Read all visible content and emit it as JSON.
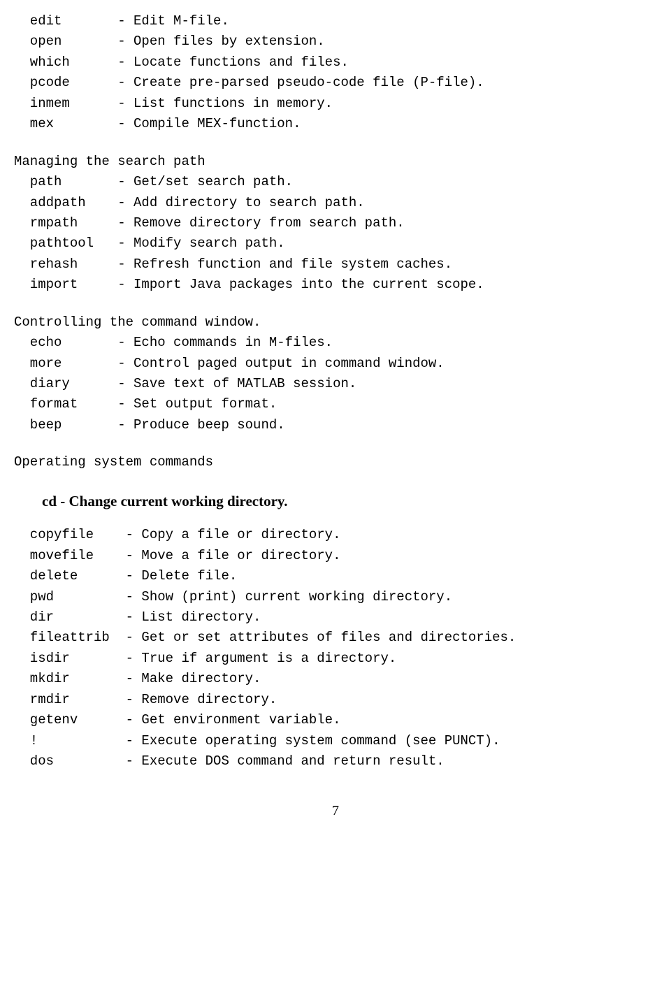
{
  "section0": [
    {
      "cmd": "  edit",
      "desc": "- Edit M-file."
    },
    {
      "cmd": "  open",
      "desc": "- Open files by extension."
    },
    {
      "cmd": "  which",
      "desc": "- Locate functions and files."
    },
    {
      "cmd": "  pcode",
      "desc": "- Create pre-parsed pseudo-code file (P-file)."
    },
    {
      "cmd": "  inmem",
      "desc": "- List functions in memory."
    },
    {
      "cmd": "  mex",
      "desc": "- Compile MEX-function."
    }
  ],
  "section1_title": "Managing the search path",
  "section1": [
    {
      "cmd": "  path",
      "desc": "- Get/set search path."
    },
    {
      "cmd": "  addpath",
      "desc": "- Add directory to search path."
    },
    {
      "cmd": "  rmpath",
      "desc": "- Remove directory from search path."
    },
    {
      "cmd": "  pathtool",
      "desc": "- Modify search path."
    },
    {
      "cmd": "  rehash",
      "desc": "- Refresh function and file system caches."
    },
    {
      "cmd": "  import",
      "desc": "- Import Java packages into the current scope."
    }
  ],
  "section2_title": "Controlling the command window.",
  "section2": [
    {
      "cmd": "  echo",
      "desc": "- Echo commands in M-files."
    },
    {
      "cmd": "  more",
      "desc": "- Control paged output in command window."
    },
    {
      "cmd": "  diary",
      "desc": "- Save text of MATLAB session."
    },
    {
      "cmd": "  format",
      "desc": "- Set output format."
    },
    {
      "cmd": "  beep",
      "desc": "- Produce beep sound."
    }
  ],
  "section3_title": "Operating system commands",
  "subheading_bold": "cd - Change current working directory.",
  "section4": [
    {
      "cmd": "  copyfile",
      "desc": "- Copy a file or directory."
    },
    {
      "cmd": "  movefile",
      "desc": "- Move a file or directory."
    },
    {
      "cmd": "  delete",
      "desc": "- Delete file."
    },
    {
      "cmd": "  pwd",
      "desc": "- Show (print) current working directory."
    },
    {
      "cmd": "  dir",
      "desc": "- List directory."
    },
    {
      "cmd": "  fileattrib",
      "desc": "- Get or set attributes of files and directories."
    },
    {
      "cmd": "  isdir",
      "desc": "- True if argument is a directory."
    },
    {
      "cmd": "  mkdir",
      "desc": "- Make directory."
    },
    {
      "cmd": "  rmdir",
      "desc": "- Remove directory."
    },
    {
      "cmd": "  getenv",
      "desc": "- Get environment variable."
    },
    {
      "cmd": "  !",
      "desc": "- Execute operating system command (see PUNCT)."
    },
    {
      "cmd": "  dos",
      "desc": "- Execute DOS command and return result."
    }
  ],
  "col0_width": 13,
  "col4_width": 14,
  "page_number": "7"
}
